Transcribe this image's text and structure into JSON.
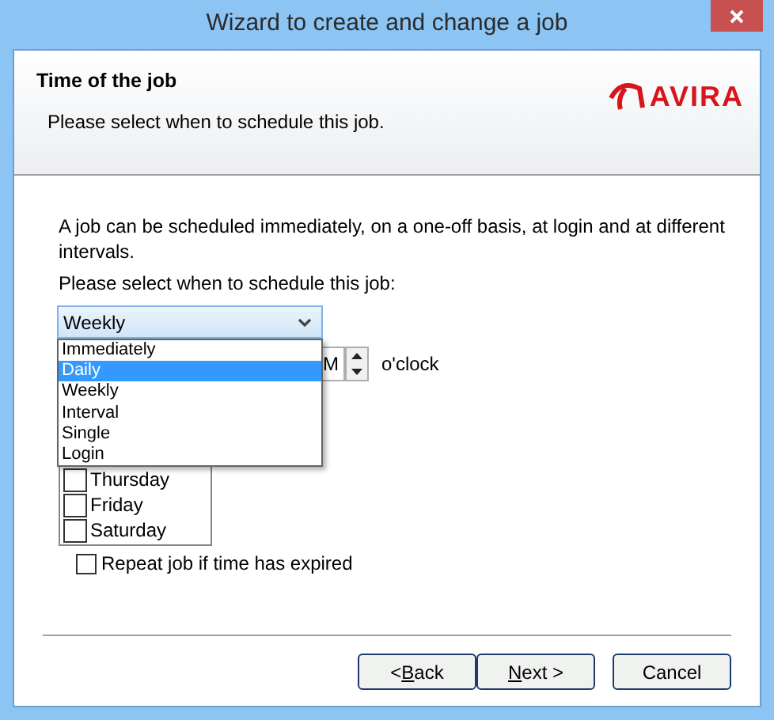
{
  "window": {
    "title": "Wizard to create and change a job"
  },
  "header": {
    "title": "Time of the job",
    "subtitle": "Please select when to schedule this job.",
    "logo": "AVIRA"
  },
  "description": "A job can be scheduled immediately, on a one-off basis, at login and at different intervals.",
  "schedule_label": "Please select when to schedule this job:",
  "schedule_combo": {
    "value": "Weekly",
    "expanded": true
  },
  "schedule_options": [
    {
      "label": "Immediately",
      "selected": false
    },
    {
      "label": "Daily",
      "selected": true
    },
    {
      "label": "Weekly",
      "selected": false
    },
    {
      "label": "Interval",
      "selected": false
    },
    {
      "label": "Single",
      "selected": false
    },
    {
      "label": "Login",
      "selected": false
    }
  ],
  "time": {
    "value": "M",
    "suffix": "o'clock"
  },
  "days": [
    {
      "label": "Thursday",
      "checked": false
    },
    {
      "label": "Friday",
      "checked": false
    },
    {
      "label": "Saturday",
      "checked": false
    }
  ],
  "repeat": {
    "label": "Repeat job if time has expired",
    "checked": false
  },
  "buttons": [
    {
      "text_before": "< ",
      "access_key": "B",
      "text_after": "ack"
    },
    {
      "access_key": "N",
      "text_after": "ext >"
    },
    {
      "text_after": "Cancel"
    }
  ]
}
